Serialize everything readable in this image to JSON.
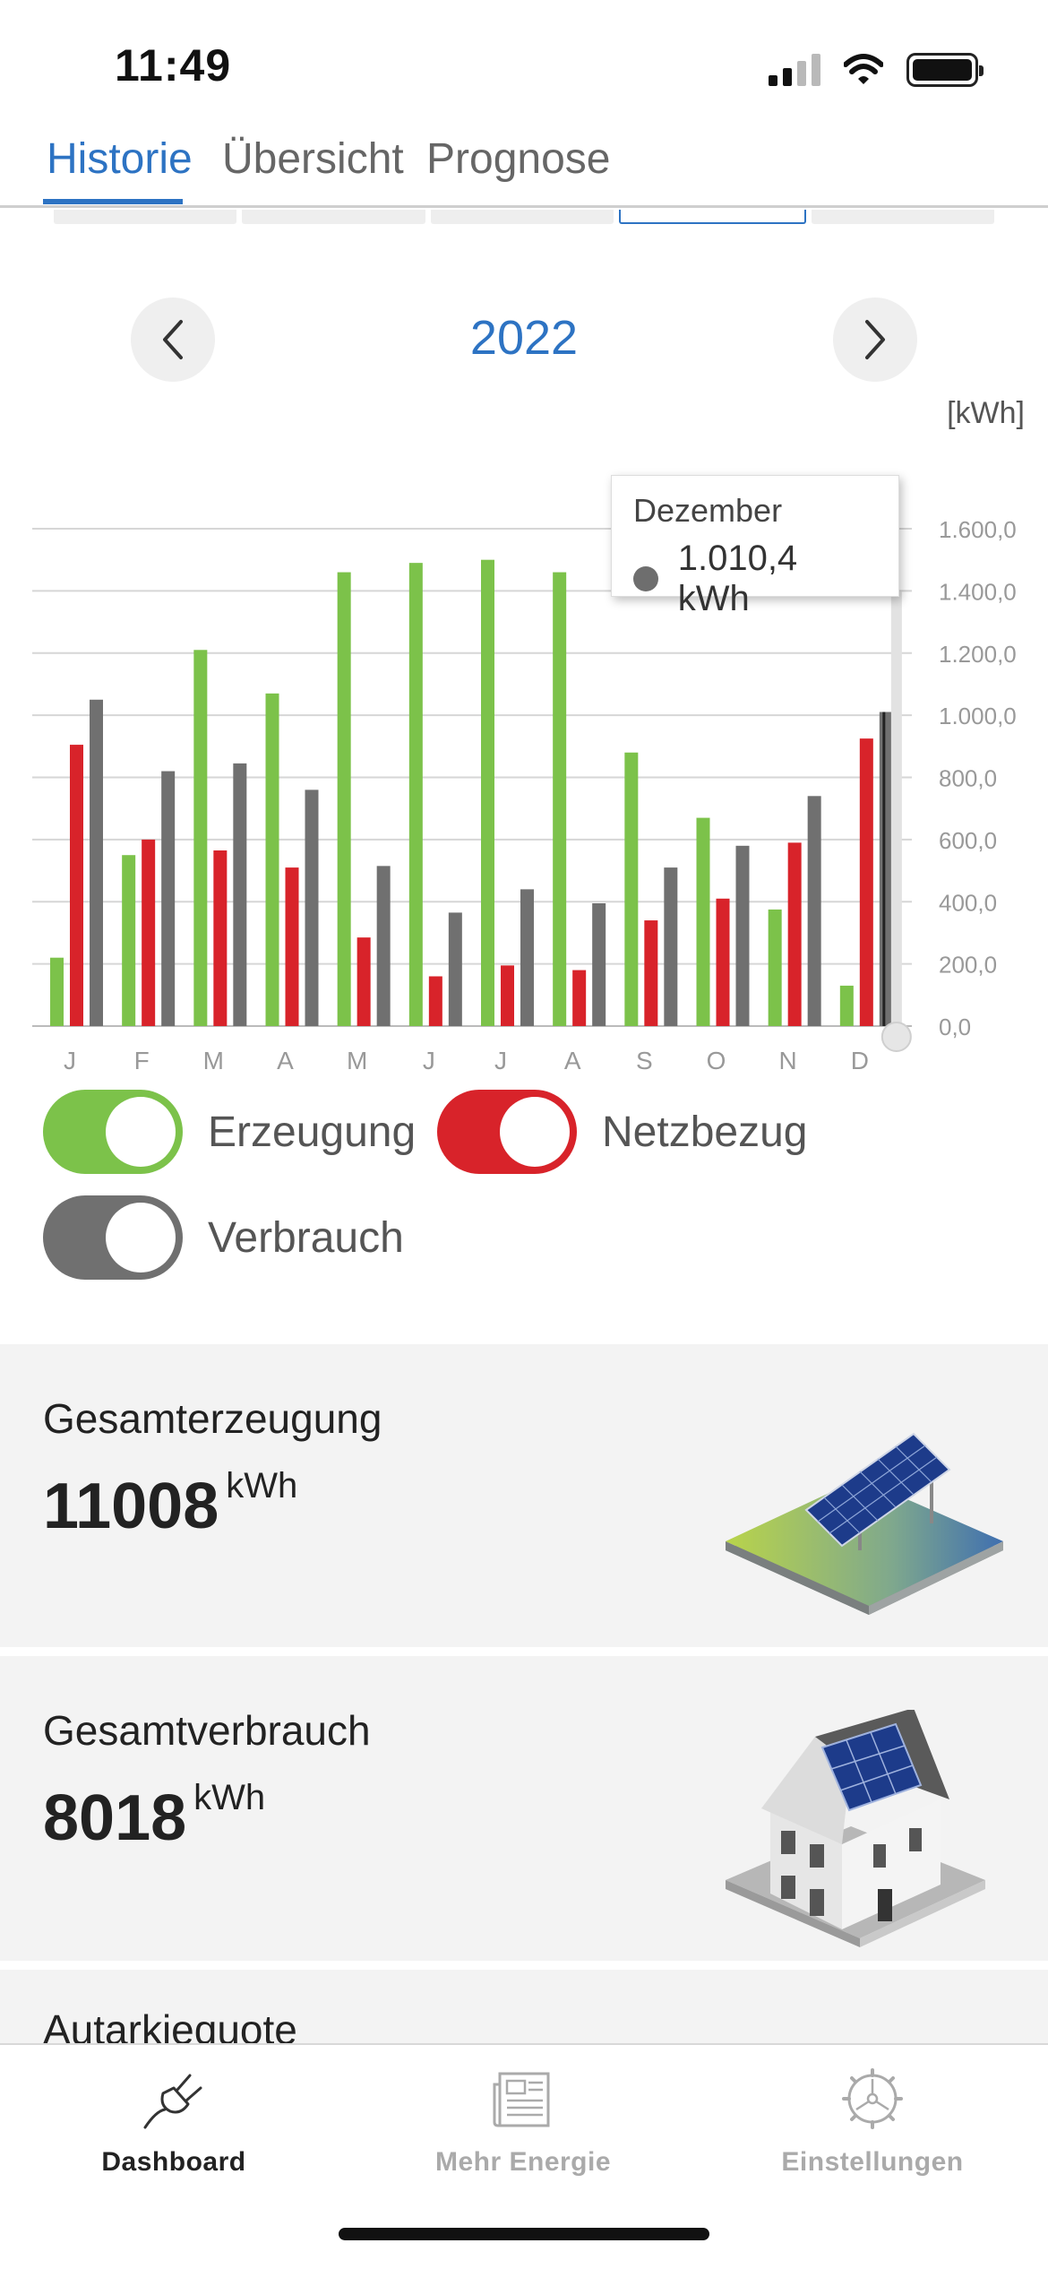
{
  "status": {
    "time": "11:49"
  },
  "tabs": [
    {
      "label": "Historie",
      "active": true
    },
    {
      "label": "Übersicht",
      "active": false
    },
    {
      "label": "Prognose",
      "active": false
    }
  ],
  "year_nav": {
    "year": "2022",
    "prev_icon": "chevron-left-icon",
    "next_icon": "chevron-right-icon"
  },
  "unit_label": "[kWh]",
  "chart_data": {
    "type": "bar",
    "categories": [
      "J",
      "F",
      "M",
      "A",
      "M",
      "J",
      "J",
      "A",
      "S",
      "O",
      "N",
      "D"
    ],
    "series": [
      {
        "name": "Erzeugung",
        "color": "#7cc24a",
        "values": [
          220,
          550,
          1210,
          1070,
          1460,
          1490,
          1500,
          1460,
          880,
          670,
          375,
          130
        ]
      },
      {
        "name": "Netzbezug",
        "color": "#d8232a",
        "values": [
          905,
          600,
          565,
          510,
          285,
          160,
          195,
          180,
          340,
          410,
          590,
          925
        ]
      },
      {
        "name": "Verbrauch",
        "color": "#707070",
        "values": [
          1050,
          820,
          845,
          760,
          515,
          365,
          440,
          395,
          510,
          580,
          740,
          1010.4
        ]
      }
    ],
    "y_ticks": [
      "0,0",
      "200,0",
      "400,0",
      "600,0",
      "800,0",
      "1.000,0",
      "1.200,0",
      "1.400,0",
      "1.600,0"
    ],
    "ylim": [
      0,
      1600
    ],
    "grid": true
  },
  "tooltip": {
    "month": "Dezember",
    "value": "1.010,4 kWh"
  },
  "toggles": [
    {
      "label": "Erzeugung",
      "color": "#7cc24a",
      "on": true
    },
    {
      "label": "Netzbezug",
      "color": "#d8232a",
      "on": true
    },
    {
      "label": "Verbrauch",
      "color": "#707070",
      "on": true
    }
  ],
  "cards": [
    {
      "title": "Gesamterzeugung",
      "value": "11008",
      "unit": "kWh",
      "image": "solar-panel-illustration"
    },
    {
      "title": "Gesamtverbrauch",
      "value": "8018",
      "unit": "kWh",
      "image": "house-illustration"
    }
  ],
  "partial_card": {
    "title": "Autarkiequote"
  },
  "bottom_nav": [
    {
      "label": "Dashboard",
      "icon": "plug-icon",
      "active": true
    },
    {
      "label": "Mehr Energie",
      "icon": "newspaper-icon",
      "active": false
    },
    {
      "label": "Einstellungen",
      "icon": "gear-icon",
      "active": false
    }
  ]
}
